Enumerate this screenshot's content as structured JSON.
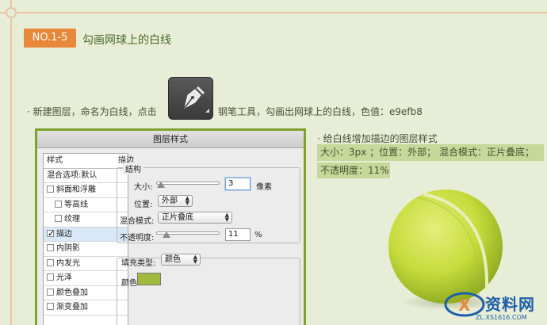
{
  "step": {
    "badge": "NO.1-5",
    "title": "勾画网球上的白线"
  },
  "intro": {
    "text_before": "· 新建图层，命名为白线，点击",
    "tool_icon": "pen-tool-icon",
    "text_after": "钢笔工具，勾画出网球上的白线，色值：e9efb8",
    "color_value": "#e9efb8"
  },
  "dialog": {
    "title": "图层样式",
    "sidebar": {
      "header": "样式",
      "blend_default": "混合选项:默认",
      "items": [
        {
          "label": "斜面和浮雕",
          "checked": false,
          "indent": false
        },
        {
          "label": "等高线",
          "checked": false,
          "indent": true
        },
        {
          "label": "纹理",
          "checked": false,
          "indent": true
        },
        {
          "label": "描边",
          "checked": true,
          "indent": false,
          "selected": true
        },
        {
          "label": "内阴影",
          "checked": false,
          "indent": false
        },
        {
          "label": "内发光",
          "checked": false,
          "indent": false
        },
        {
          "label": "光泽",
          "checked": false,
          "indent": false
        },
        {
          "label": "颜色叠加",
          "checked": false,
          "indent": false
        },
        {
          "label": "渐变叠加",
          "checked": false,
          "indent": false
        }
      ]
    },
    "stroke": {
      "section_title": "描边",
      "structure_title": "结构",
      "size_label": "大小:",
      "size_value": "3",
      "size_unit": "像素",
      "size_level": 0.03,
      "position_label": "位置:",
      "position_value": "外部",
      "blend_label": "混合模式:",
      "blend_value": "正片叠底",
      "opacity_label": "不透明度:",
      "opacity_value": "11",
      "opacity_unit": "%",
      "opacity_level": 0.11,
      "fill_type_label": "填充类型:",
      "fill_type_value": "颜色",
      "color_label": "颜色:",
      "color_hex": "#9fba3d"
    }
  },
  "tips": {
    "heading": "· 给白线增加描边的图层样式",
    "line1": "大小：3px ；位置：外部；  混合模式：正片叠底；",
    "line2": "不透明度：11%"
  },
  "watermark": {
    "text": "资料网",
    "url": "ZL.XS1616.COM"
  },
  "colors": {
    "background": "#e7edd7",
    "badge": "#e8883a",
    "accent_green": "#7fa12e",
    "highlight": "#c6d89a"
  }
}
